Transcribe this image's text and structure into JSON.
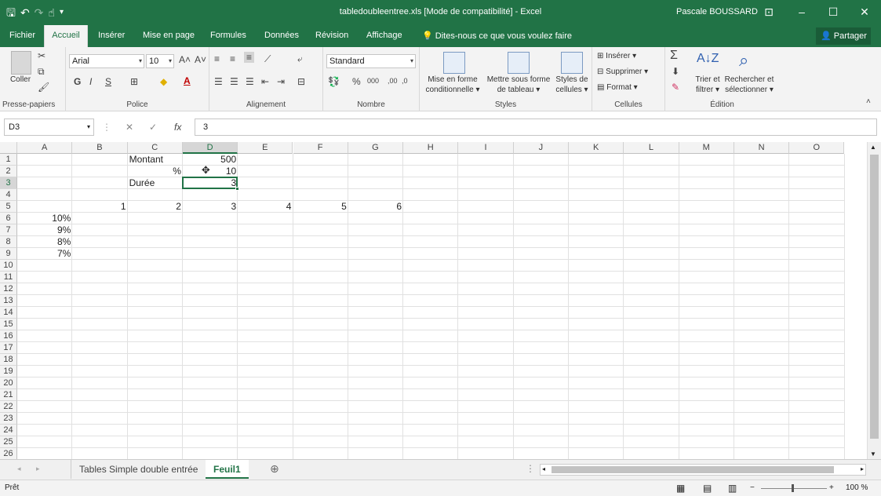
{
  "window": {
    "title": "tabledoubleentree.xls  [Mode de compatibilité] - Excel",
    "user": "Pascale BOUSSARD"
  },
  "tabs": [
    "Fichier",
    "Accueil",
    "Insérer",
    "Mise en page",
    "Formules",
    "Données",
    "Révision",
    "Affichage"
  ],
  "tell_me": "Dites-nous ce que vous voulez faire",
  "share": "Partager",
  "ribbon": {
    "paste": "Coller",
    "font_name": "Arial",
    "font_size": "10",
    "bold": "G",
    "italic": "I",
    "underline": "S",
    "number_format": "Standard",
    "percent": "%",
    "thousands": "000",
    "cond_format": [
      "Mise en forme",
      "conditionnelle"
    ],
    "table_format": [
      "Mettre sous forme",
      "de tableau"
    ],
    "cell_styles": [
      "Styles de",
      "cellules"
    ],
    "insert": "Insérer",
    "delete": "Supprimer",
    "format": "Format",
    "sort": [
      "Trier et",
      "filtrer"
    ],
    "find": [
      "Rechercher et",
      "sélectionner"
    ],
    "groups": {
      "clipboard": "Presse-papiers",
      "font": "Police",
      "alignment": "Alignement",
      "number": "Nombre",
      "styles": "Styles",
      "cells": "Cellules",
      "editing": "Édition"
    }
  },
  "formula_bar": {
    "name_box": "D3",
    "fx": "fx",
    "content": "3"
  },
  "grid": {
    "columns": [
      "A",
      "B",
      "C",
      "D",
      "E",
      "F",
      "G",
      "H",
      "I",
      "J",
      "K",
      "L",
      "M",
      "N",
      "O"
    ],
    "rows": [
      "1",
      "2",
      "3",
      "4",
      "5",
      "6",
      "7",
      "8",
      "9",
      "10",
      "11",
      "12",
      "13",
      "14",
      "15",
      "16",
      "17",
      "18",
      "19",
      "20",
      "21",
      "22",
      "23",
      "24",
      "25",
      "26"
    ],
    "selected_cell": "D3",
    "cells": {
      "C1": "Montant",
      "D1": "500",
      "C2": "%",
      "D2": "10",
      "C3": "Durée",
      "D3": "3",
      "B5": "1",
      "C5": "2",
      "D5": "3",
      "E5": "4",
      "F5": "5",
      "G5": "6",
      "A6": "10%",
      "A7": "9%",
      "A8": "8%",
      "A9": "7%"
    }
  },
  "sheets": [
    "Tables Simple double entrée",
    "Feuil1"
  ],
  "active_sheet": "Feuil1",
  "status": {
    "mode": "Prêt",
    "zoom": "100 %"
  }
}
